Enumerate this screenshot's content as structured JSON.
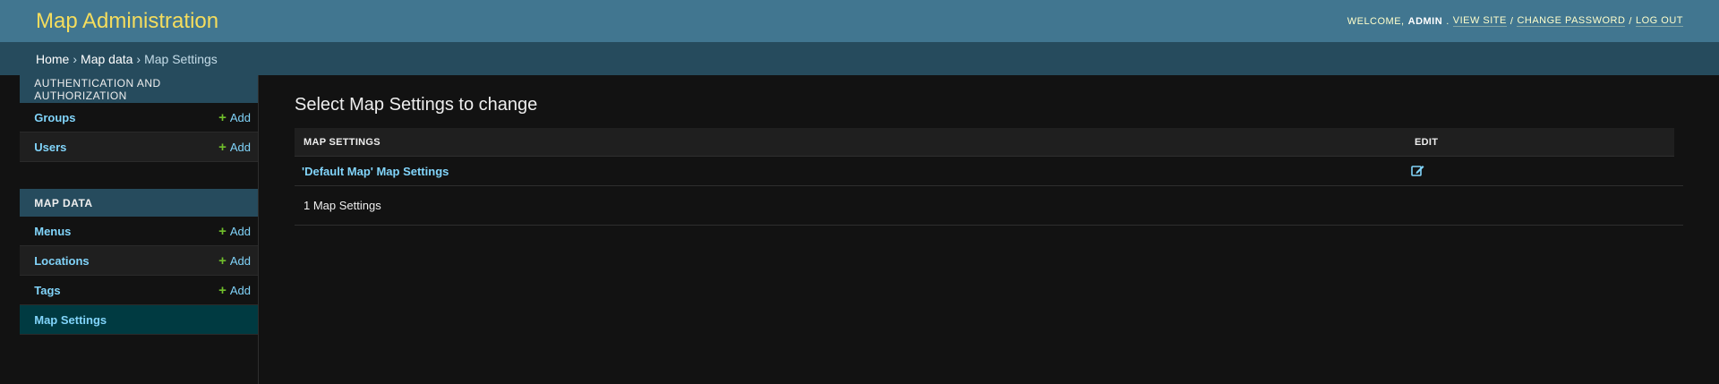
{
  "header": {
    "site_title": "Map Administration",
    "welcome": "Welcome,",
    "username": "admin",
    "period": ".",
    "view_site": "View site",
    "change_password": "Change password",
    "log_out": "Log out",
    "separator": "/"
  },
  "breadcrumbs": {
    "home": "Home",
    "app": "Map data",
    "current": "Map Settings",
    "separator": "›"
  },
  "sidebar": {
    "modules": [
      {
        "caption": "Authentication and Authorization",
        "models": [
          {
            "label": "Groups",
            "add": "Add"
          },
          {
            "label": "Users",
            "add": "Add"
          }
        ]
      },
      {
        "caption": "Map data",
        "models": [
          {
            "label": "Menus",
            "add": "Add"
          },
          {
            "label": "Locations",
            "add": "Add"
          },
          {
            "label": "Tags",
            "add": "Add"
          },
          {
            "label": "Map Settings"
          }
        ]
      }
    ],
    "add_icon": "plus-icon"
  },
  "content": {
    "title": "Select Map Settings to change",
    "columns": [
      "Map Settings",
      "Edit"
    ],
    "rows": [
      {
        "name": "'Default Map' Map Settings",
        "edit_icon": "edit-icon"
      }
    ],
    "count_text": "1 Map Settings"
  },
  "colors": {
    "header_bg": "#417690",
    "title": "#f5dd5d",
    "breadcrumb_bg": "#264b5d",
    "link": "#81d4fa",
    "add_plus": "#70bf2b",
    "active_row": "#003a41"
  }
}
